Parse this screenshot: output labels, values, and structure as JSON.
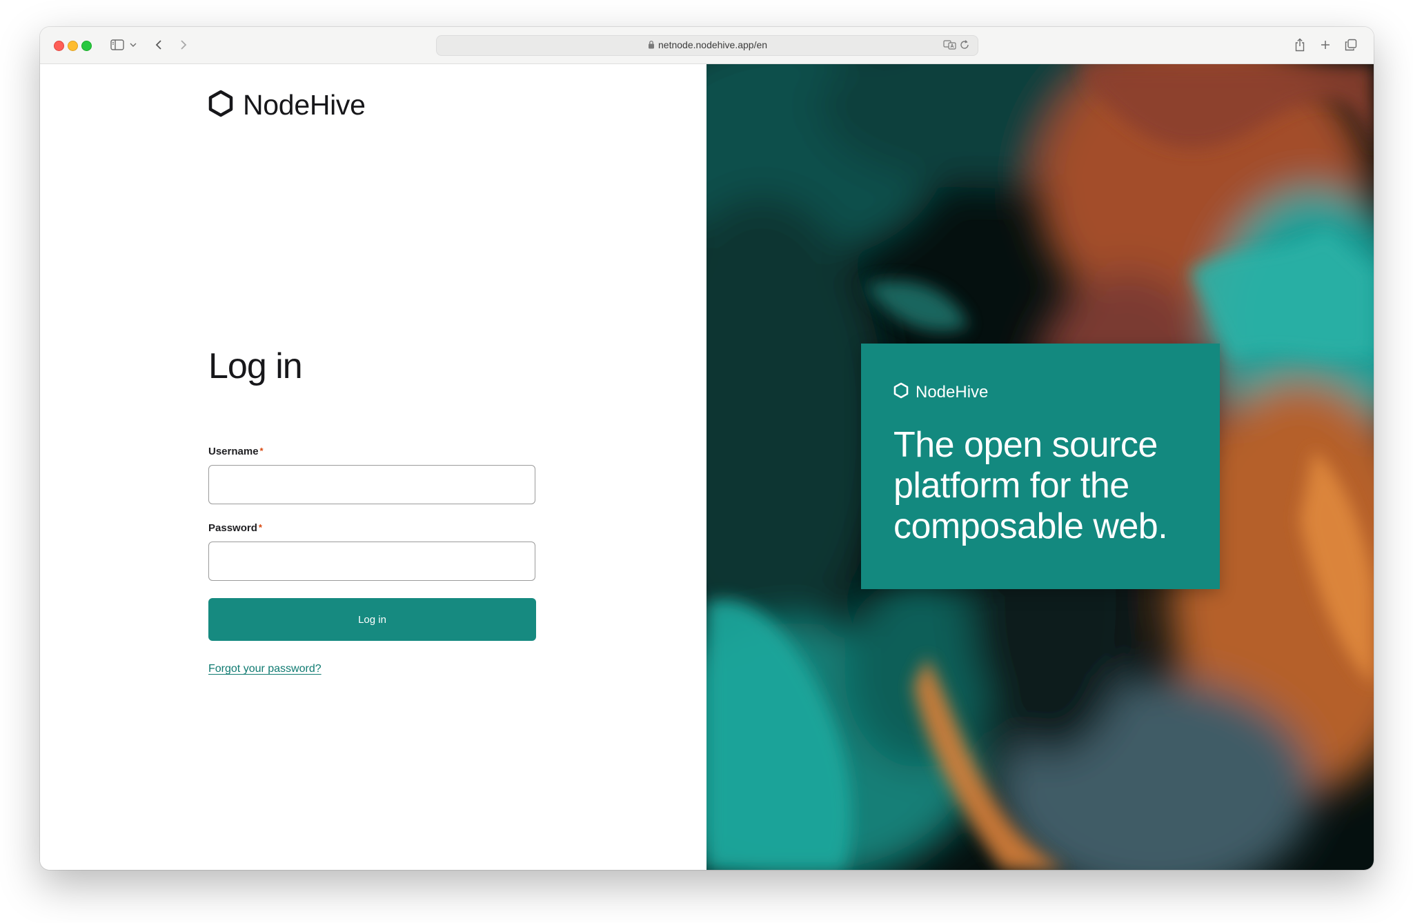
{
  "browser": {
    "url": "netnode.nodehive.app/en",
    "icons": [
      "sidebar-icon",
      "chevron-down-icon",
      "back-icon",
      "forward-icon",
      "lock-icon",
      "translate-icon",
      "reload-icon",
      "share-icon",
      "new-tab-icon",
      "tabs-overview-icon"
    ]
  },
  "brand": {
    "name": "NodeHive",
    "icon": "hexagon-icon"
  },
  "login": {
    "title": "Log in",
    "username_label": "Username",
    "password_label": "Password",
    "required_marker": "*",
    "username_value": "",
    "password_value": "",
    "submit_label": "Log in",
    "forgot_link": "Forgot your password?"
  },
  "promo": {
    "brand": "NodeHive",
    "headline": "The open source platform for the composable web."
  },
  "colors": {
    "accent": "#168a80",
    "promo_bg": "#13897f",
    "required": "#d9480f",
    "link": "#0f7a71"
  }
}
